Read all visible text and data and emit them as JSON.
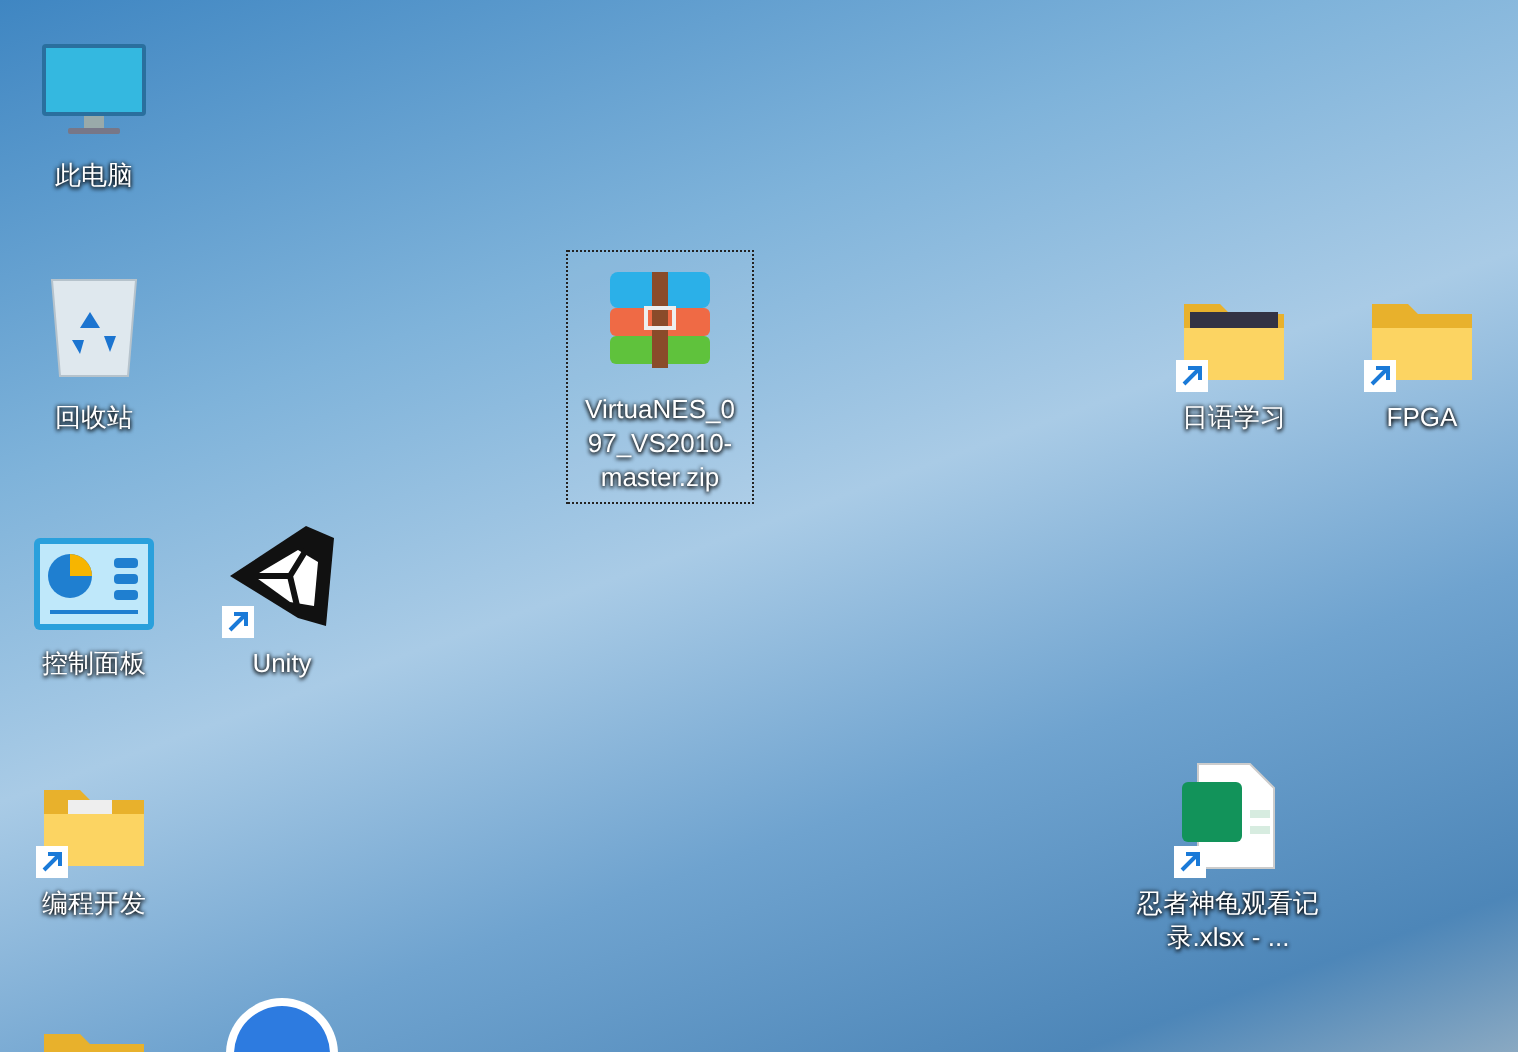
{
  "desktop": {
    "icons": [
      {
        "kind": "computer",
        "label": "此电脑",
        "shortcut": false,
        "selected": false
      },
      {
        "kind": "recycle-bin",
        "label": "回收站",
        "shortcut": false,
        "selected": false
      },
      {
        "kind": "archive",
        "label": "VirtuaNES_097_VS2010-master.zip",
        "shortcut": false,
        "selected": true
      },
      {
        "kind": "photo-folder",
        "label": "日语学习",
        "shortcut": true,
        "selected": false
      },
      {
        "kind": "folder",
        "label": "FPGA",
        "shortcut": true,
        "selected": false
      },
      {
        "kind": "control-panel",
        "label": "控制面板",
        "shortcut": false,
        "selected": false
      },
      {
        "kind": "unity",
        "label": "Unity",
        "shortcut": true,
        "selected": false
      },
      {
        "kind": "doc-folder",
        "label": "编程开发",
        "shortcut": true,
        "selected": false
      },
      {
        "kind": "spreadsheet",
        "label": "忍者神龟观看记录.xlsx - ...",
        "shortcut": true,
        "selected": false
      },
      {
        "kind": "logo-folder",
        "shortcut": false,
        "selected": false
      },
      {
        "kind": "round-logo",
        "shortcut": false,
        "selected": false
      }
    ]
  }
}
